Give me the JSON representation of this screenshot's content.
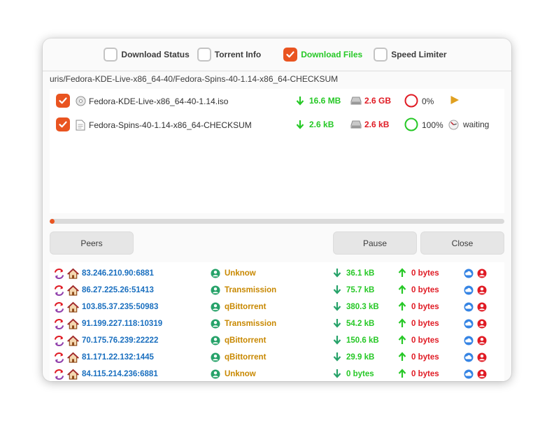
{
  "tabs": [
    {
      "label": "Download Status",
      "checked": false
    },
    {
      "label": "Torrent Info",
      "checked": false
    },
    {
      "label": "Download Files",
      "checked": true
    },
    {
      "label": "Speed Limiter",
      "checked": false
    }
  ],
  "path": "uris/Fedora-KDE-Live-x86_64-40/Fedora-Spins-40-1.14-x86_64-CHECKSUM",
  "files": [
    {
      "name": "Fedora-KDE-Live-x86_64-40-1.14.iso",
      "icon": "disc-icon",
      "downloaded": "16.6 MB",
      "size": "2.6 GB",
      "percent": "0%",
      "status": "",
      "status_icon": "play-icon"
    },
    {
      "name": "Fedora-Spins-40-1.14-x86_64-CHECKSUM",
      "icon": "document-icon",
      "downloaded": "2.6 kB",
      "size": "2.6 kB",
      "percent": "100%",
      "status": "waiting",
      "status_icon": "clock-icon"
    }
  ],
  "overall_progress": 0.01,
  "buttons": {
    "peers": "Peers",
    "pause": "Pause",
    "close": "Close"
  },
  "peers": [
    {
      "ip": "83.246.210.90:6881",
      "client": "Unknow",
      "down": "36.1 kB",
      "up": "0 bytes"
    },
    {
      "ip": "86.27.225.26:51413",
      "client": "Transmission",
      "down": "75.7 kB",
      "up": "0 bytes"
    },
    {
      "ip": "103.85.37.235:50983",
      "client": "qBittorrent",
      "down": "380.3 kB",
      "up": "0 bytes"
    },
    {
      "ip": "91.199.227.118:10319",
      "client": "Transmission",
      "down": "54.2 kB",
      "up": "0 bytes"
    },
    {
      "ip": "70.175.76.239:22222",
      "client": "qBittorrent",
      "down": "150.6 kB",
      "up": "0 bytes"
    },
    {
      "ip": "81.171.22.132:1445",
      "client": "qBittorrent",
      "down": "29.9 kB",
      "up": "0 bytes"
    },
    {
      "ip": "84.115.214.236:6881",
      "client": "Unknow",
      "down": "0 bytes",
      "up": "0 bytes"
    }
  ],
  "colors": {
    "accent": "#e95420",
    "green": "#26c826",
    "red": "#e01b24",
    "client": "#c88800",
    "ip": "#1a6fbf"
  }
}
